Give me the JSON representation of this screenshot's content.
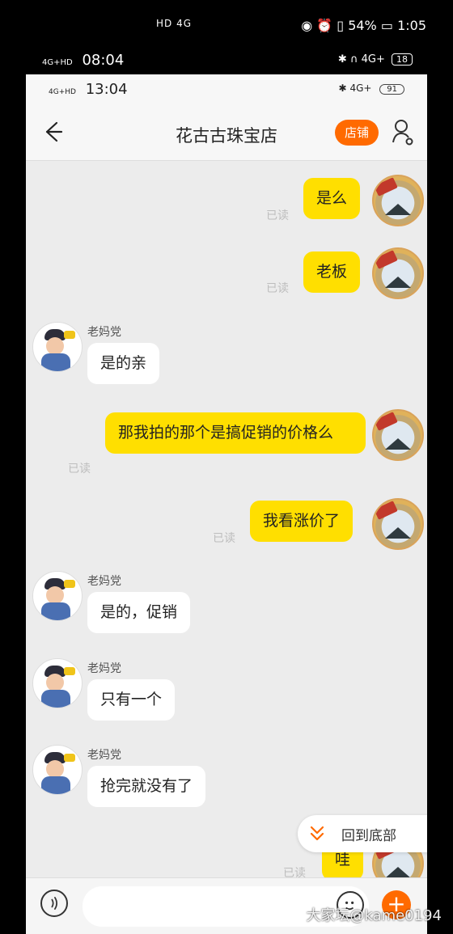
{
  "outer_status": {
    "left_icons": "HD 4G",
    "battery": "54%",
    "time": "1:05"
  },
  "status2": {
    "signal": "4G+HD",
    "time": "08:04",
    "net": "4G+",
    "battery": "18"
  },
  "inner_status": {
    "signal": "4G+HD",
    "time": "13:04",
    "net": "4G+",
    "battery": "91"
  },
  "header": {
    "title": "花古古珠宝店",
    "shop_button": "店铺"
  },
  "messages": [
    {
      "from": "me",
      "text": "是么",
      "status": "已读"
    },
    {
      "from": "me",
      "text": "老板",
      "status": "已读"
    },
    {
      "from": "other",
      "nickname": "老妈党",
      "text": "是的亲"
    },
    {
      "from": "me",
      "text": "那我拍的那个是搞促销的价格么",
      "status": "已读"
    },
    {
      "from": "me",
      "text": "我看涨价了",
      "status": "已读"
    },
    {
      "from": "other",
      "nickname": "老妈党",
      "text": "是的，促销"
    },
    {
      "from": "other",
      "nickname": "老妈党",
      "text": "只有一个"
    },
    {
      "from": "other",
      "nickname": "老妈党",
      "text": "抢完就没有了"
    },
    {
      "from": "me",
      "text": "哇",
      "status": "已读"
    }
  ],
  "scroll_to_bottom": "回到底部",
  "input": {
    "placeholder": ""
  },
  "watermark": "大家坛@kame0194"
}
